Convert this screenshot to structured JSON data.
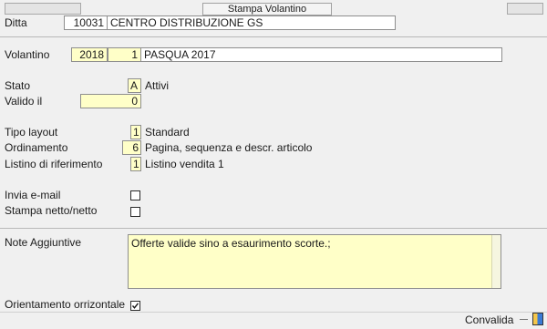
{
  "window": {
    "title": "Stampa Volantino"
  },
  "ditta": {
    "label": "Ditta",
    "code": "10031",
    "name": "CENTRO DISTRIBUZIONE GS"
  },
  "volantino": {
    "label": "Volantino",
    "year": "2018",
    "number": "1",
    "description": "PASQUA 2017"
  },
  "stato": {
    "label": "Stato",
    "code": "A",
    "description": "Attivi"
  },
  "valido_il": {
    "label": "Valido il",
    "value": "0"
  },
  "tipo_layout": {
    "label": "Tipo layout",
    "code": "1",
    "description": "Standard"
  },
  "ordinamento": {
    "label": "Ordinamento",
    "code": "6",
    "description": "Pagina, sequenza e descr. articolo"
  },
  "listino": {
    "label": "Listino di riferimento",
    "code": "1",
    "description": "Listino vendita 1"
  },
  "invia_email": {
    "label": "Invia e-mail",
    "checked": false
  },
  "stampa_netto": {
    "label": "Stampa netto/netto",
    "checked": false
  },
  "note": {
    "label": "Note Aggiuntive",
    "value": "Offerte valide sino a esaurimento scorte.;"
  },
  "orientamento": {
    "label": "Orientamento orrizontale",
    "checked": true
  },
  "footer": {
    "convalida_label": "Convalida"
  }
}
